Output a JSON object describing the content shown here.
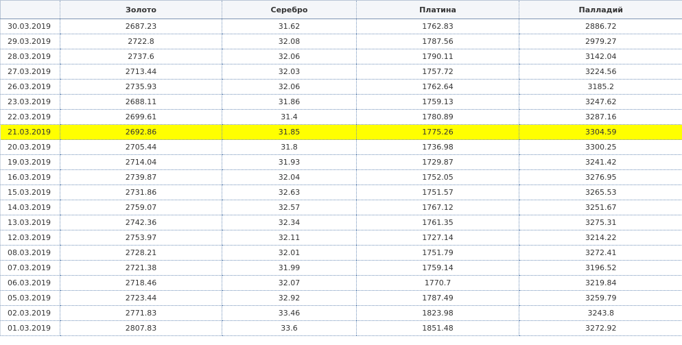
{
  "table": {
    "headers": [
      "",
      "Золото",
      "Серебро",
      "Платина",
      "Палладий"
    ],
    "highlight_color": "#ffff00",
    "rows": [
      {
        "date": "30.03.2019",
        "gold": "2687.23",
        "silver": "31.62",
        "platinum": "1762.83",
        "palladium": "2886.72",
        "highlighted": false
      },
      {
        "date": "29.03.2019",
        "gold": "2722.8",
        "silver": "32.08",
        "platinum": "1787.56",
        "palladium": "2979.27",
        "highlighted": false
      },
      {
        "date": "28.03.2019",
        "gold": "2737.6",
        "silver": "32.06",
        "platinum": "1790.11",
        "palladium": "3142.04",
        "highlighted": false
      },
      {
        "date": "27.03.2019",
        "gold": "2713.44",
        "silver": "32.03",
        "platinum": "1757.72",
        "palladium": "3224.56",
        "highlighted": false
      },
      {
        "date": "26.03.2019",
        "gold": "2735.93",
        "silver": "32.06",
        "platinum": "1762.64",
        "palladium": "3185.2",
        "highlighted": false
      },
      {
        "date": "23.03.2019",
        "gold": "2688.11",
        "silver": "31.86",
        "platinum": "1759.13",
        "palladium": "3247.62",
        "highlighted": false
      },
      {
        "date": "22.03.2019",
        "gold": "2699.61",
        "silver": "31.4",
        "platinum": "1780.89",
        "palladium": "3287.16",
        "highlighted": false
      },
      {
        "date": "21.03.2019",
        "gold": "2692.86",
        "silver": "31.85",
        "platinum": "1775.26",
        "palladium": "3304.59",
        "highlighted": true
      },
      {
        "date": "20.03.2019",
        "gold": "2705.44",
        "silver": "31.8",
        "platinum": "1736.98",
        "palladium": "3300.25",
        "highlighted": false
      },
      {
        "date": "19.03.2019",
        "gold": "2714.04",
        "silver": "31.93",
        "platinum": "1729.87",
        "palladium": "3241.42",
        "highlighted": false
      },
      {
        "date": "16.03.2019",
        "gold": "2739.87",
        "silver": "32.04",
        "platinum": "1752.05",
        "palladium": "3276.95",
        "highlighted": false
      },
      {
        "date": "15.03.2019",
        "gold": "2731.86",
        "silver": "32.63",
        "platinum": "1751.57",
        "palladium": "3265.53",
        "highlighted": false
      },
      {
        "date": "14.03.2019",
        "gold": "2759.07",
        "silver": "32.57",
        "platinum": "1767.12",
        "palladium": "3251.67",
        "highlighted": false
      },
      {
        "date": "13.03.2019",
        "gold": "2742.36",
        "silver": "32.34",
        "platinum": "1761.35",
        "palladium": "3275.31",
        "highlighted": false
      },
      {
        "date": "12.03.2019",
        "gold": "2753.97",
        "silver": "32.11",
        "platinum": "1727.14",
        "palladium": "3214.22",
        "highlighted": false
      },
      {
        "date": "08.03.2019",
        "gold": "2728.21",
        "silver": "32.01",
        "platinum": "1751.79",
        "palladium": "3272.41",
        "highlighted": false
      },
      {
        "date": "07.03.2019",
        "gold": "2721.38",
        "silver": "31.99",
        "platinum": "1759.14",
        "palladium": "3196.52",
        "highlighted": false
      },
      {
        "date": "06.03.2019",
        "gold": "2718.46",
        "silver": "32.07",
        "platinum": "1770.7",
        "palladium": "3219.84",
        "highlighted": false
      },
      {
        "date": "05.03.2019",
        "gold": "2723.44",
        "silver": "32.92",
        "platinum": "1787.49",
        "palladium": "3259.79",
        "highlighted": false
      },
      {
        "date": "02.03.2019",
        "gold": "2771.83",
        "silver": "33.46",
        "platinum": "1823.98",
        "palladium": "3243.8",
        "highlighted": false
      },
      {
        "date": "01.03.2019",
        "gold": "2807.83",
        "silver": "33.6",
        "platinum": "1851.48",
        "palladium": "3272.92",
        "highlighted": false
      }
    ]
  }
}
